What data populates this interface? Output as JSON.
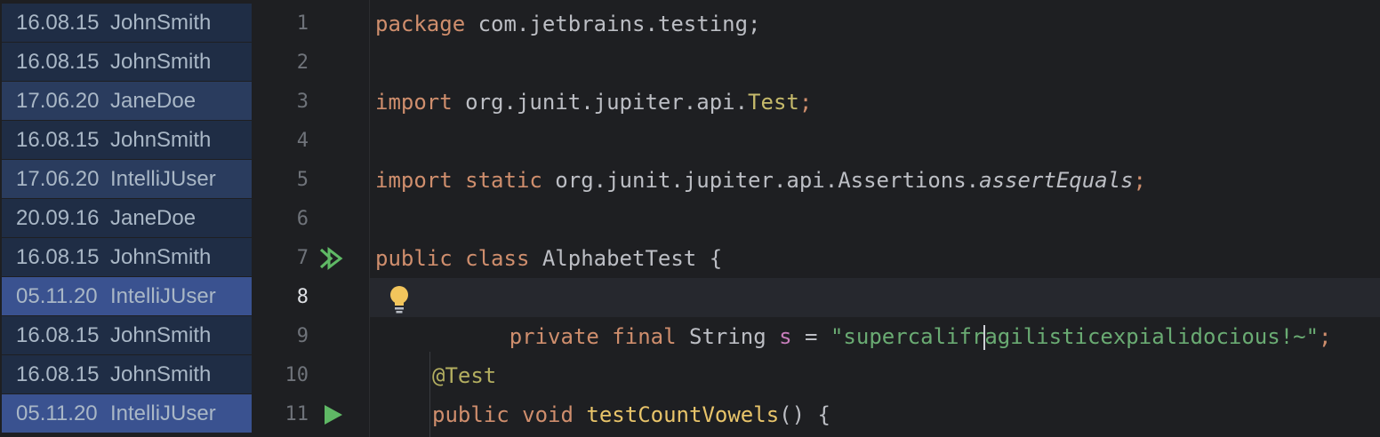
{
  "colors": {
    "background": "#1e1f22",
    "annotation_dark": "#1f2d45",
    "annotation_mid": "#2a3c5e",
    "annotation_bright": "#3a5290",
    "keyword": "#cf8e6d",
    "string": "#6aab73",
    "annotation": "#b3ae60",
    "run_icon": "#5fb865"
  },
  "annotations": [
    {
      "date": "16.08.15",
      "author": "JohnSmith",
      "shade": "dark"
    },
    {
      "date": "16.08.15",
      "author": "JohnSmith",
      "shade": "dark"
    },
    {
      "date": "17.06.20",
      "author": "JaneDoe",
      "shade": "mid"
    },
    {
      "date": "16.08.15",
      "author": "JohnSmith",
      "shade": "dark"
    },
    {
      "date": "17.06.20",
      "author": "IntelliJUser",
      "shade": "mid"
    },
    {
      "date": "20.09.16",
      "author": "JaneDoe",
      "shade": "dark"
    },
    {
      "date": "16.08.15",
      "author": "JohnSmith",
      "shade": "dark"
    },
    {
      "date": "05.11.20",
      "author": "IntelliJUser",
      "shade": "bright"
    },
    {
      "date": "16.08.15",
      "author": "JohnSmith",
      "shade": "dark"
    },
    {
      "date": "16.08.15",
      "author": "JohnSmith",
      "shade": "dark"
    },
    {
      "date": "05.11.20",
      "author": "IntelliJUser",
      "shade": "bright"
    }
  ],
  "line_numbers": [
    "1",
    "2",
    "3",
    "4",
    "5",
    "6",
    "7",
    "8",
    "9",
    "10",
    "11"
  ],
  "current_line": "8",
  "gutter_icons": {
    "line7": "run-all-tests-icon",
    "line8": "lightbulb-icon",
    "line11": "run-test-icon"
  },
  "code": {
    "l1_kw": "package",
    "l1_rest": " com.jetbrains.testing;",
    "l3_kw": "import",
    "l3_pkg": " org.junit.jupiter.api.",
    "l3_cls": "Test",
    "l3_semi": ";",
    "l5_kw1": "import",
    "l5_kw2": " static",
    "l5_pkg": " org.junit.jupiter.api.Assertions.",
    "l5_method": "assertEquals",
    "l5_semi": ";",
    "l7_kw1": "public",
    "l7_kw2": " class",
    "l7_rest": " AlphabetTest {",
    "l8_kw1": "private",
    "l8_kw2": " final",
    "l8_type": " String ",
    "l8_field": "s",
    "l8_eq": " = ",
    "l8_str_a": "\"supercalifr",
    "l8_str_b": "agilisticexpialidocious!~\"",
    "l8_semi": ";",
    "l10_annotation": "@Test",
    "l11_kw1": "public",
    "l11_kw2": " void",
    "l11_method": " testCountVowels",
    "l11_rest": "() {"
  }
}
